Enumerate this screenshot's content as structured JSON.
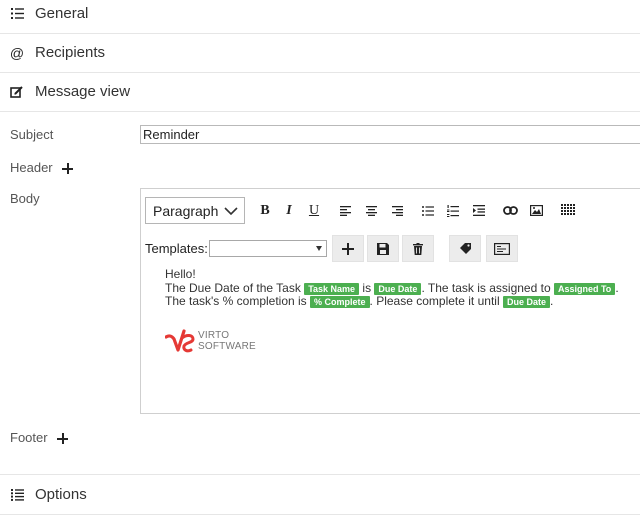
{
  "sections": {
    "general": {
      "label": "General",
      "icon": "list-icon"
    },
    "recipients": {
      "label": "Recipients",
      "icon": "at-icon"
    },
    "message_view": {
      "label": "Message view",
      "icon": "edit-icon"
    },
    "options": {
      "label": "Options",
      "icon": "options-list-icon"
    }
  },
  "form": {
    "subject_label": "Subject",
    "subject_value": "Reminder",
    "header_label": "Header",
    "body_label": "Body",
    "footer_label": "Footer"
  },
  "editor": {
    "format_value": "Paragraph",
    "bold_glyph": "B",
    "italic_glyph": "I",
    "underline_glyph": "U",
    "templates_label": "Templates:",
    "templates_value": ""
  },
  "message": {
    "greeting": "Hello!",
    "line2_a": "The Due Date of the Task",
    "tag_task_name": "Task Name",
    "line2_b": "is",
    "tag_due_date": "Due Date",
    "line2_c": ". The task is assigned to",
    "tag_assigned_to": "Assigned To",
    "line2_d": ".",
    "line3_a": "The task's % completion is",
    "tag_percent_complete": "% Complete",
    "line3_b": ". Please complete it until",
    "tag_due_date_2": "Due Date",
    "line3_c": "."
  },
  "logo": {
    "line1": "VIRTO",
    "line2": "SOFTWARE"
  },
  "colors": {
    "tag_green": "#4caf50",
    "logo_red": "#e53935"
  }
}
